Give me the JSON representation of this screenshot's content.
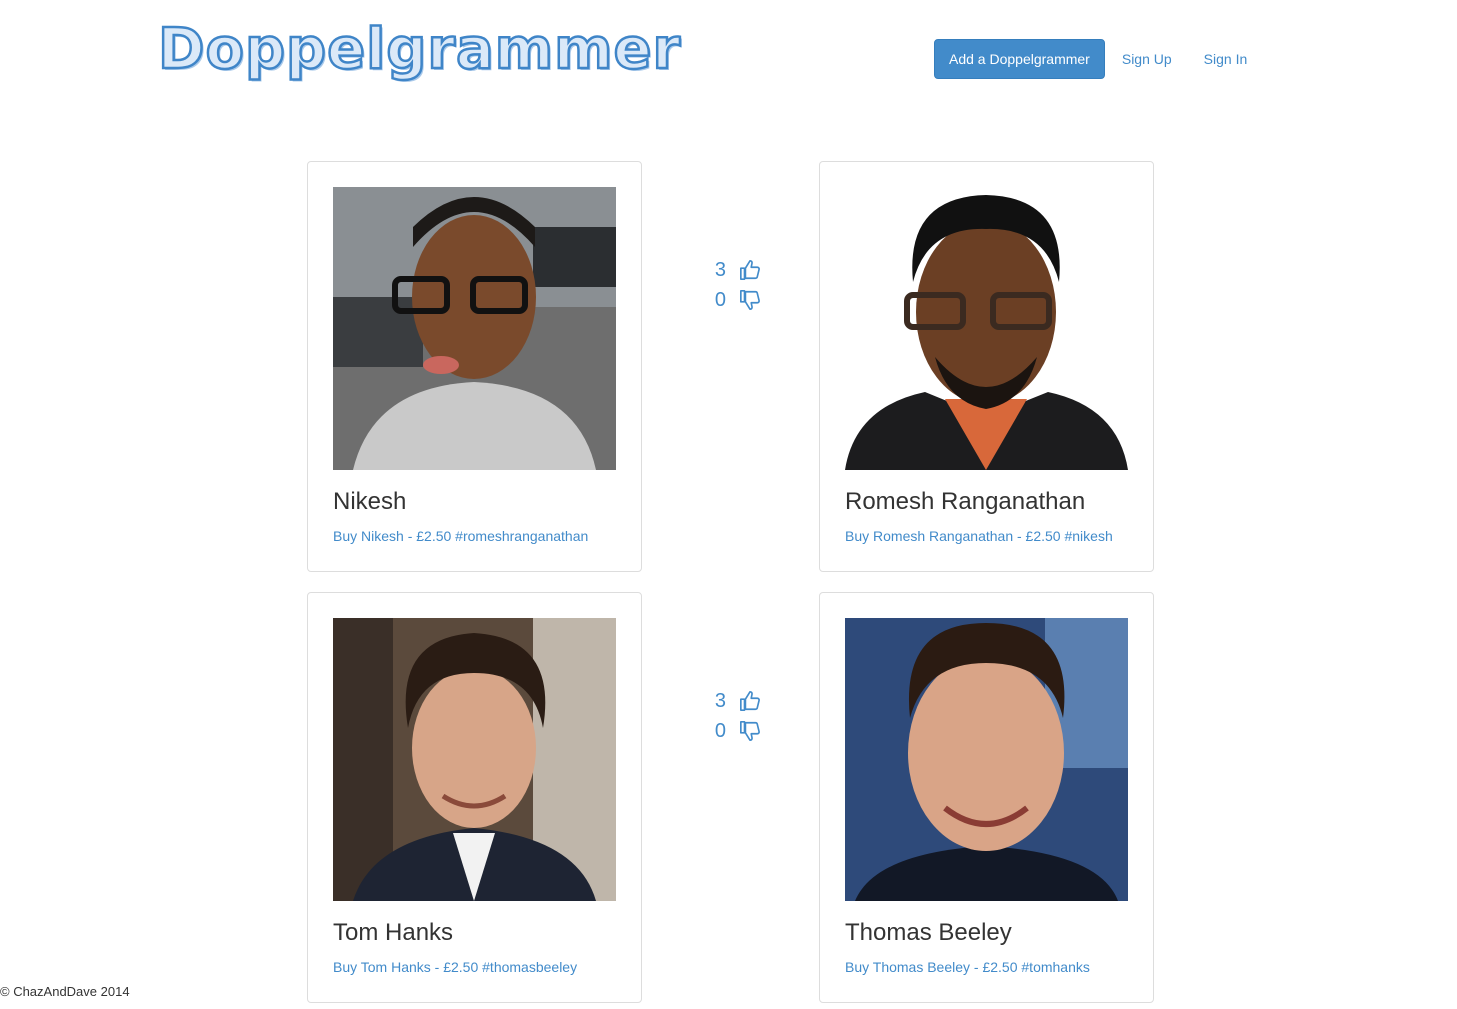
{
  "header": {
    "logo_text": "Doppelgrammer",
    "add_button_label": "Add a Doppelgrammer",
    "sign_up_label": "Sign Up",
    "sign_in_label": "Sign In"
  },
  "pairs": [
    {
      "left": {
        "name": "Nikesh",
        "buy_text": "Buy Nikesh - £2.50 #romeshranganathan"
      },
      "right": {
        "name": "Romesh Ranganathan",
        "buy_text": "Buy Romesh Ranganathan - £2.50 #nikesh"
      },
      "votes": {
        "up": "3",
        "down": "0"
      }
    },
    {
      "left": {
        "name": "Tom Hanks",
        "buy_text": "Buy Tom Hanks - £2.50 #thomasbeeley"
      },
      "right": {
        "name": "Thomas Beeley",
        "buy_text": "Buy Thomas Beeley - £2.50 #tomhanks"
      },
      "votes": {
        "up": "3",
        "down": "0"
      }
    }
  ],
  "footer": {
    "text": "© ChazAndDave 2014"
  },
  "icons": {
    "upvote": "thumbs-up-icon",
    "downvote": "thumbs-down-icon"
  },
  "colors": {
    "accent": "#428bca",
    "card_border": "#dddddd"
  }
}
